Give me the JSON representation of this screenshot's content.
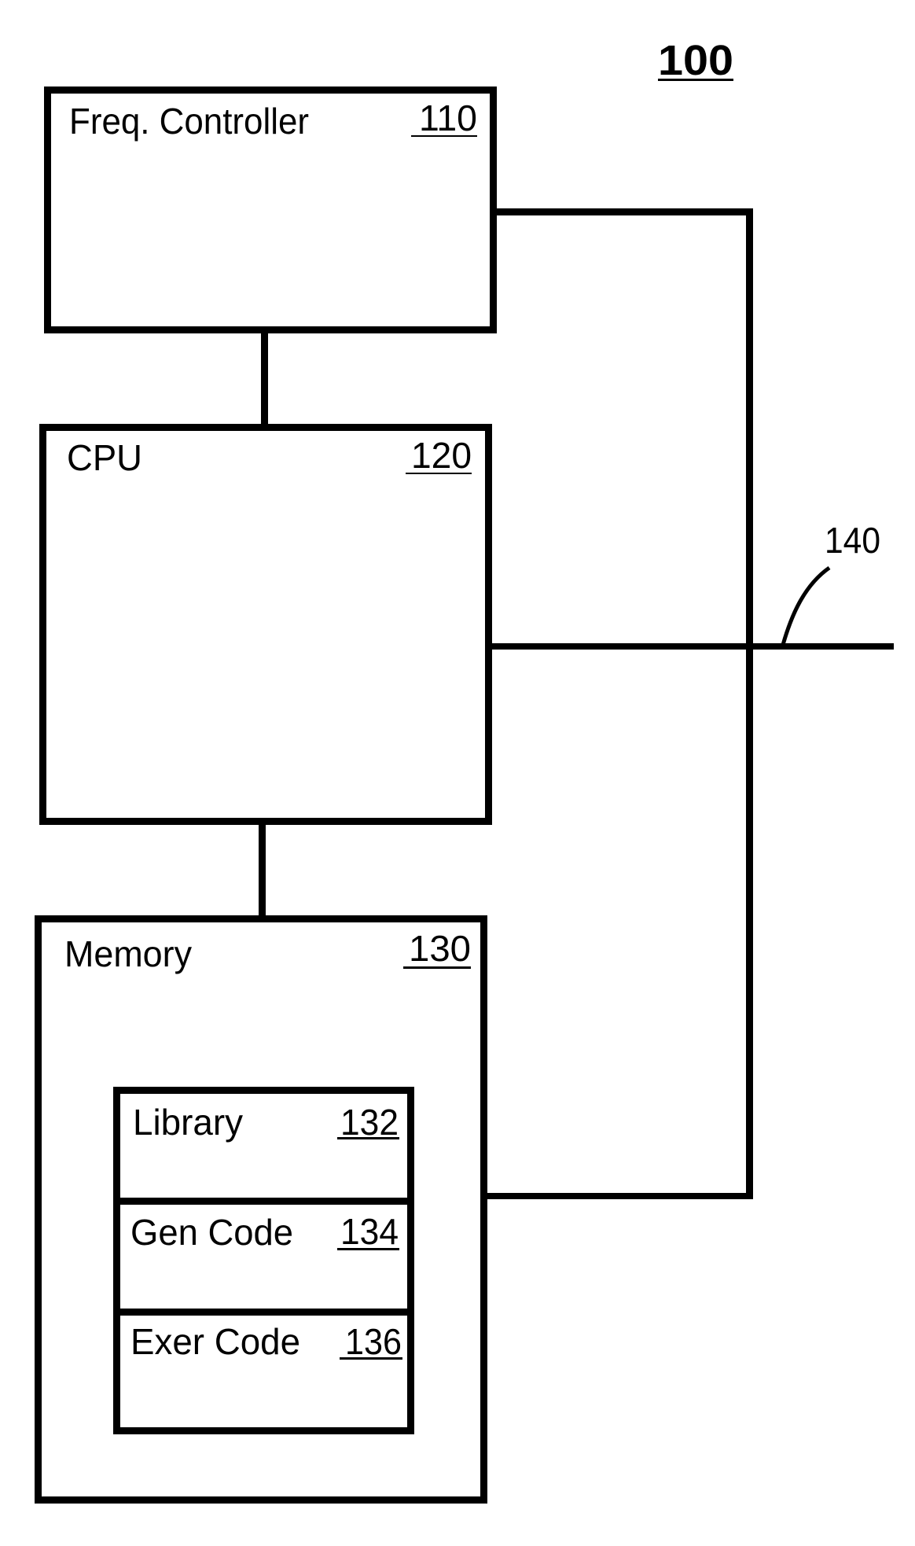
{
  "figure": {
    "number": "100",
    "line_color": "#000000",
    "background": "#ffffff"
  },
  "blocks": {
    "freq_controller": {
      "label": "Freq. Controller",
      "ref": "110"
    },
    "cpu": {
      "label": "CPU",
      "ref": "120"
    },
    "memory": {
      "label": "Memory",
      "ref": "130"
    },
    "library": {
      "label": "Library",
      "ref": "132"
    },
    "gen_code": {
      "label": "Gen Code",
      "ref": "134"
    },
    "exer_code": {
      "label": "Exer Code",
      "ref": "136"
    }
  },
  "bus": {
    "ref": "140"
  }
}
